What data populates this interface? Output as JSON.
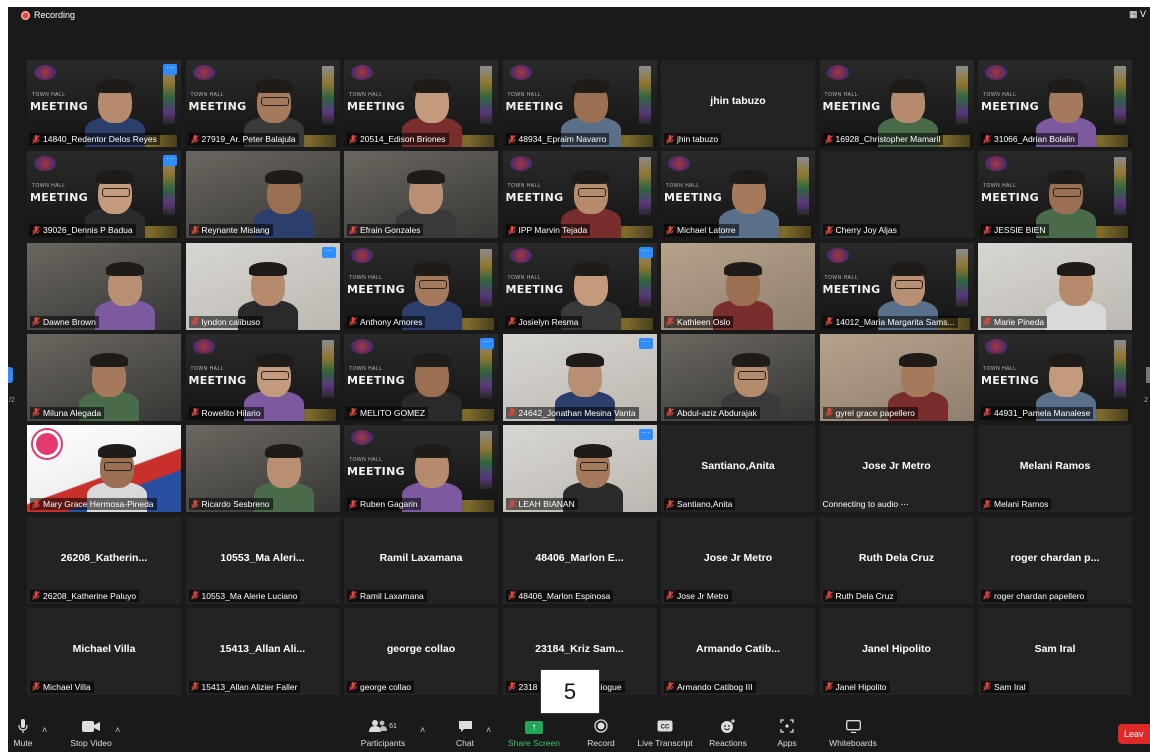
{
  "recording_label": "Recording",
  "view_label": "V",
  "hover_page_number": "5",
  "page_left": "/2",
  "page_right": "2",
  "participants": [
    {
      "name": "14840_Redentor Delos Reyes",
      "kind": "video-meeting",
      "more": true
    },
    {
      "name": "27919_Ar. Peter Balajula",
      "kind": "video-meeting"
    },
    {
      "name": "20514_Edison Briones",
      "kind": "video-meeting"
    },
    {
      "name": "48934_Epraim Navarro",
      "kind": "video-meeting"
    },
    {
      "name": "jhin tabuzo",
      "kind": "name-only",
      "display": "jhin tabuzo"
    },
    {
      "name": "16928_Christopher Mamaril",
      "kind": "video-meeting"
    },
    {
      "name": "31066_Adrian Bolalin",
      "kind": "video-meeting"
    },
    {
      "name": "39026_Dennis P Badua",
      "kind": "video-meeting",
      "more": true
    },
    {
      "name": "Reynante Mislang",
      "kind": "video-room"
    },
    {
      "name": "Efrain Gonzales",
      "kind": "video-room"
    },
    {
      "name": "IPP Marvin Tejada",
      "kind": "video-meeting"
    },
    {
      "name": "Michael Latorre",
      "kind": "video-meeting"
    },
    {
      "name": "Cherry Joy Aljas",
      "kind": "blank"
    },
    {
      "name": "JESSIE BIEN",
      "kind": "video-meeting"
    },
    {
      "name": "Dawne Brown",
      "kind": "video-room"
    },
    {
      "name": "lyndon calibuso",
      "kind": "video-light",
      "more": true
    },
    {
      "name": "Anthony Amores",
      "kind": "video-meeting"
    },
    {
      "name": "Josielyn Resma",
      "kind": "video-meeting",
      "more": true
    },
    {
      "name": "Kathleen Oslo",
      "kind": "video-warm"
    },
    {
      "name": "14012_Maria Margarita Sams...",
      "kind": "video-meeting"
    },
    {
      "name": "Marie Pineda",
      "kind": "video-light"
    },
    {
      "name": "Miluna Alegada",
      "kind": "video-room"
    },
    {
      "name": "Rowelito Hilario",
      "kind": "video-meeting"
    },
    {
      "name": "MELITO GOMEZ",
      "kind": "video-meeting",
      "more": true
    },
    {
      "name": "24642_Jonathan Mesina Vanta",
      "kind": "video-light",
      "more": true
    },
    {
      "name": "Abdul-aziz Abdurajak",
      "kind": "video-room"
    },
    {
      "name": "gyrel grace papellero",
      "kind": "video-warm"
    },
    {
      "name": "44931_Pamela Manalese",
      "kind": "video-meeting"
    },
    {
      "name": "Mary Grace Hermosa-Pineda",
      "kind": "video-flag"
    },
    {
      "name": "Ricardo Sesbreno",
      "kind": "video-room"
    },
    {
      "name": "Ruben Gagarin",
      "kind": "video-meeting"
    },
    {
      "name": "LEAH BIANAN",
      "kind": "video-light",
      "more": true
    },
    {
      "name": "Santiano,Anita",
      "kind": "name-only",
      "display": "Santiano,Anita"
    },
    {
      "name": "Connecting to audio ⋯",
      "kind": "name-only",
      "display": "Jose Jr Metro",
      "connecting": true
    },
    {
      "name": "Melani Ramos",
      "kind": "name-only",
      "display": "Melani Ramos"
    },
    {
      "name": "26208_Katherine Paluyo",
      "kind": "name-only",
      "display": "26208_Katherin..."
    },
    {
      "name": "10553_Ma Alerie Luciano",
      "kind": "name-only",
      "display": "10553_Ma Aleri..."
    },
    {
      "name": "Ramil Laxamana",
      "kind": "name-only",
      "display": "Ramil Laxamana"
    },
    {
      "name": "48406_Marlon Espinosa",
      "kind": "name-only",
      "display": "48406_Marlon E..."
    },
    {
      "name": "Jose Jr Metro",
      "kind": "name-only",
      "display": "Jose Jr Metro"
    },
    {
      "name": "Ruth Dela Cruz",
      "kind": "name-only",
      "display": "Ruth Dela Cruz"
    },
    {
      "name": "roger chardan papellero",
      "kind": "name-only",
      "display": "roger chardan p..."
    },
    {
      "name": "Michael Villa",
      "kind": "name-only",
      "display": "Michael Villa"
    },
    {
      "name": "15413_Allan Alizier Faller",
      "kind": "name-only",
      "display": "15413_Allan Ali..."
    },
    {
      "name": "george collao",
      "kind": "name-only",
      "display": "george collao"
    },
    {
      "name": "2318",
      "name_tail": "Quiogue",
      "kind": "name-only",
      "display": "23184_Kriz Sam..."
    },
    {
      "name": "Armando Catibog III",
      "kind": "name-only",
      "display": "Armando  Catib..."
    },
    {
      "name": "Janel Hipolito",
      "kind": "name-only",
      "display": "Janel Hipolito"
    },
    {
      "name": "Sam Iral",
      "kind": "name-only",
      "display": "Sam Iral"
    }
  ],
  "meeting_text": "MEETING",
  "meeting_sub": "TOWN HALL",
  "toolbar": {
    "mute": "Mute",
    "stop_video": "Stop Video",
    "participants": "Participants",
    "participants_count": "61",
    "chat": "Chat",
    "share_screen": "Share Screen",
    "record": "Record",
    "live_transcript": "Live Transcript",
    "reactions": "Reactions",
    "apps": "Apps",
    "whiteboards": "Whiteboards",
    "leave": "Leav"
  },
  "colors": {
    "muted_mic": "#e0483e",
    "share_green": "#23a65a",
    "leave_red": "#e02828",
    "more_blue": "#2d8cff"
  }
}
